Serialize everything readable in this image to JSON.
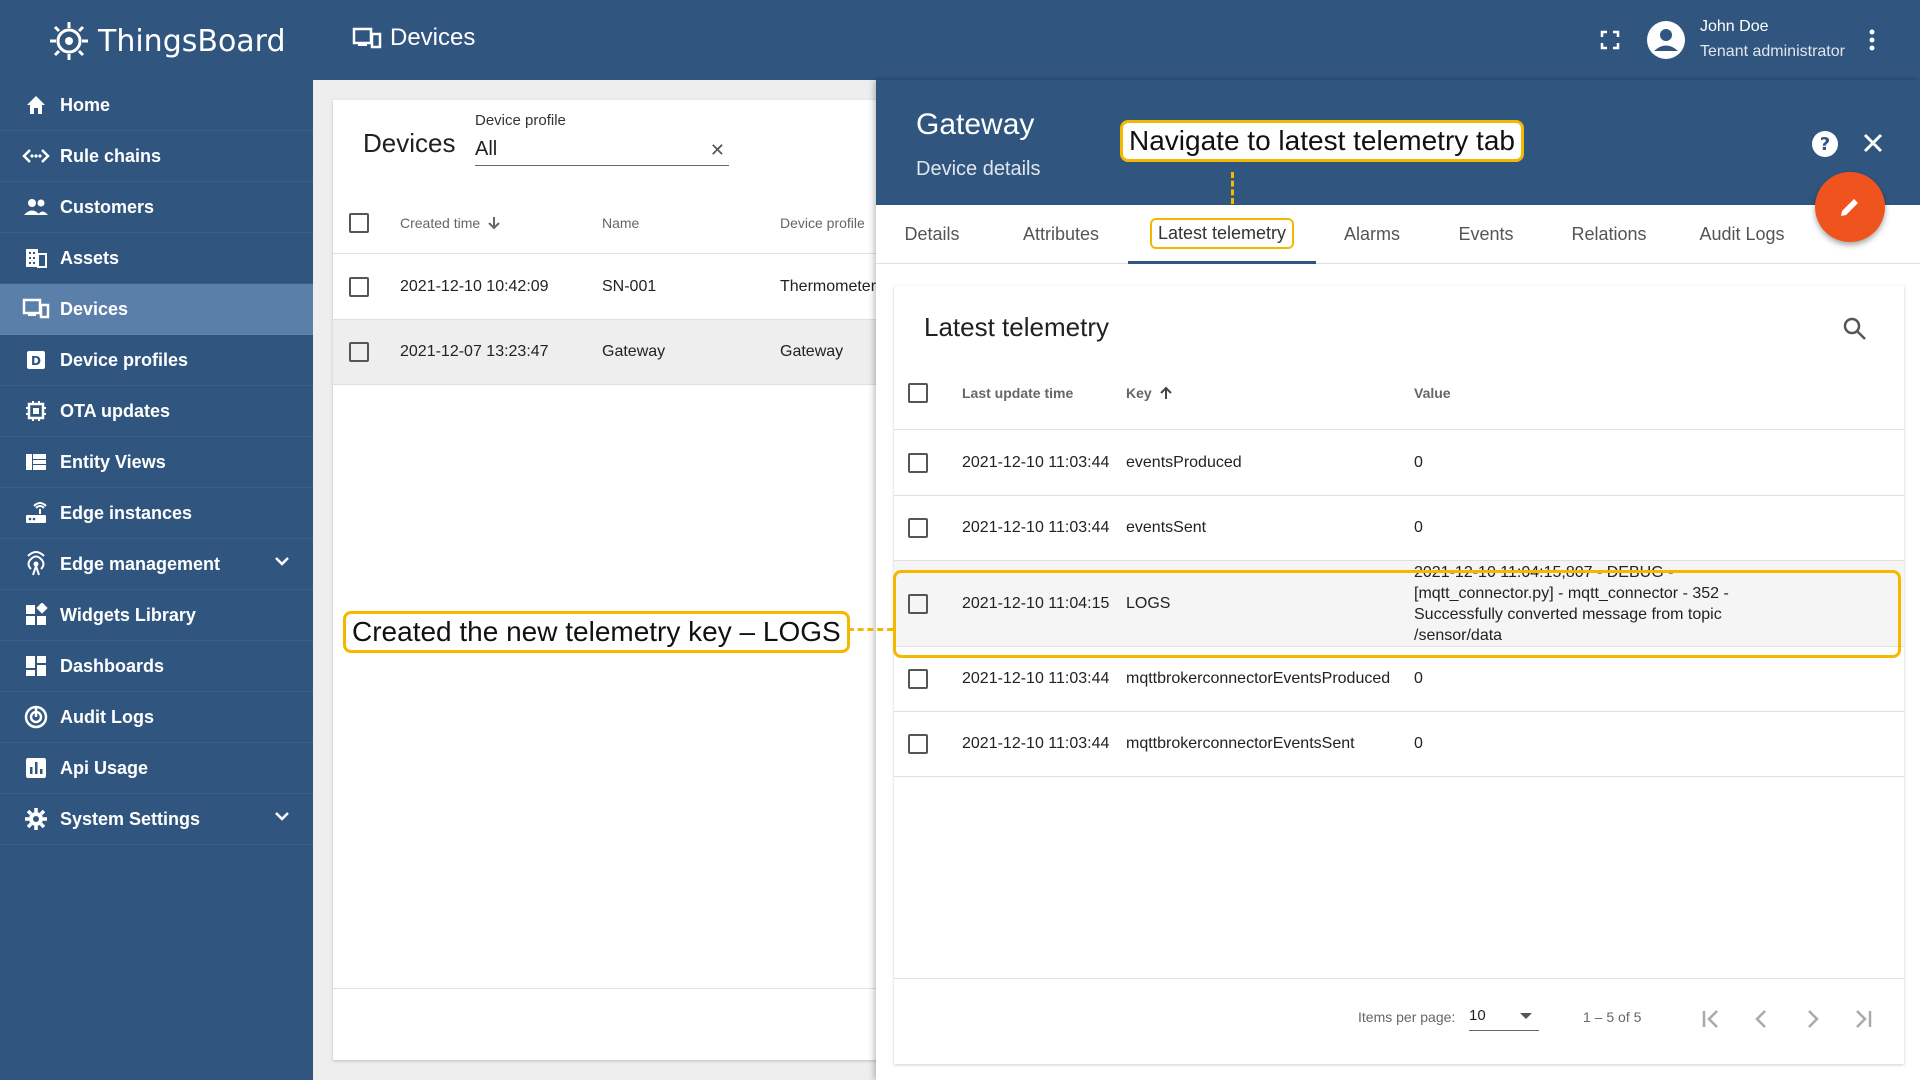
{
  "app": {
    "brand": "ThingsBoard",
    "page_title": "Devices"
  },
  "user": {
    "name": "John Doe",
    "role": "Tenant administrator"
  },
  "colors": {
    "primary": "#305680",
    "accent": "#f0541e",
    "highlight": "#f5b800",
    "active_nav": "#5a7fa8"
  },
  "sidebar": {
    "items": [
      {
        "label": "Home",
        "icon": "home-icon"
      },
      {
        "label": "Rule chains",
        "icon": "rule-chains-icon"
      },
      {
        "label": "Customers",
        "icon": "customers-icon"
      },
      {
        "label": "Assets",
        "icon": "assets-icon"
      },
      {
        "label": "Devices",
        "icon": "devices-icon",
        "active": true
      },
      {
        "label": "Device profiles",
        "icon": "device-profiles-icon"
      },
      {
        "label": "OTA updates",
        "icon": "ota-updates-icon"
      },
      {
        "label": "Entity Views",
        "icon": "entity-views-icon"
      },
      {
        "label": "Edge instances",
        "icon": "edge-instances-icon"
      },
      {
        "label": "Edge management",
        "icon": "edge-management-icon",
        "expandable": true
      },
      {
        "label": "Widgets Library",
        "icon": "widgets-library-icon"
      },
      {
        "label": "Dashboards",
        "icon": "dashboards-icon"
      },
      {
        "label": "Audit Logs",
        "icon": "audit-logs-icon"
      },
      {
        "label": "Api Usage",
        "icon": "api-usage-icon"
      },
      {
        "label": "System Settings",
        "icon": "system-settings-icon",
        "expandable": true
      }
    ]
  },
  "device_list": {
    "title": "Devices",
    "filter": {
      "label": "Device profile",
      "value": "All"
    },
    "columns": [
      "Created time",
      "Name",
      "Device profile"
    ],
    "rows": [
      {
        "created": "2021-12-10 10:42:09",
        "name": "SN-001",
        "profile": "Thermometer"
      },
      {
        "created": "2021-12-07 13:23:47",
        "name": "Gateway",
        "profile": "Gateway",
        "selected": true
      }
    ]
  },
  "details": {
    "title": "Gateway",
    "subtitle": "Device details",
    "tabs": [
      "Details",
      "Attributes",
      "Latest telemetry",
      "Alarms",
      "Events",
      "Relations",
      "Audit Logs"
    ],
    "active_tab": 2,
    "telemetry": {
      "title": "Latest telemetry",
      "columns": [
        "Last update time",
        "Key",
        "Value"
      ],
      "rows": [
        {
          "time": "2021-12-10 11:03:44",
          "key": "eventsProduced",
          "value": "0"
        },
        {
          "time": "2021-12-10 11:03:44",
          "key": "eventsSent",
          "value": "0"
        },
        {
          "time": "2021-12-10 11:04:15",
          "key": "LOGS",
          "value": "2021-12-10 11:04:15,807 - DEBUG - [mqtt_connector.py] - mqtt_connector - 352 - Successfully converted message from topic /sensor/data",
          "highlighted": true
        },
        {
          "time": "2021-12-10 11:03:44",
          "key": "mqttbrokerconnectorEventsProduced",
          "value": "0"
        },
        {
          "time": "2021-12-10 11:03:44",
          "key": "mqttbrokerconnectorEventsSent",
          "value": "0"
        }
      ],
      "footer": {
        "items_per_page_label": "Items per page:",
        "items_per_page": "10",
        "range": "1 – 5 of 5"
      }
    }
  },
  "callouts": {
    "tab": "Navigate to latest telemetry tab",
    "key": "Created the new telemetry key – LOGS"
  }
}
